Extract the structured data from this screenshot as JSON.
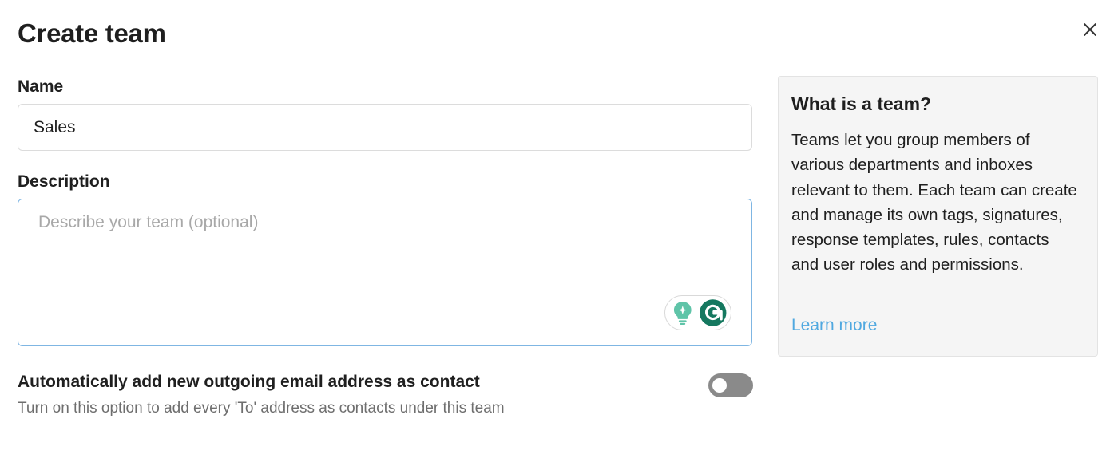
{
  "dialog": {
    "title": "Create team",
    "close_icon": "close-icon"
  },
  "form": {
    "name_label": "Name",
    "name_value": "Sales",
    "description_label": "Description",
    "description_value": "",
    "description_placeholder": "Describe your team (optional)",
    "grammarly_icons": [
      "lightbulb-icon",
      "grammarly-icon"
    ],
    "grammarly_colors": {
      "bulb": "#5fc4a8",
      "g": "#15785f"
    }
  },
  "auto_contact": {
    "title": "Automatically add new outgoing email address as contact",
    "description": "Turn on this option to add every 'To' address as contacts under this team",
    "enabled": false,
    "toggle_color": "#8a8a8a"
  },
  "info_panel": {
    "title": "What is a team?",
    "body": "Teams let you group members of various departments and inboxes relevant to them. Each team can create and manage its own tags, signatures, response templates, rules, contacts and user roles and permissions.",
    "link_label": "Learn more",
    "link_color": "#4fa8e0",
    "background": "#f5f5f5"
  }
}
